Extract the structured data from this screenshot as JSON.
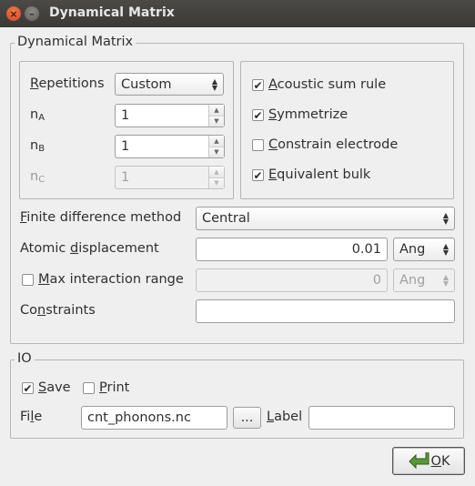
{
  "window": {
    "title": "Dynamical Matrix",
    "close_glyph": "×",
    "minimize_glyph": "–"
  },
  "dynamical_matrix_group": {
    "legend": "Dynamical Matrix",
    "repetitions": {
      "label_mnemonic": "R",
      "label_rest": "epetitions",
      "value": "Custom"
    },
    "n_a": {
      "base": "n",
      "sub": "A",
      "value": "1"
    },
    "n_b": {
      "base": "n",
      "sub": "B",
      "value": "1"
    },
    "n_c": {
      "base": "n",
      "sub": "C",
      "value": "1"
    },
    "checkboxes": {
      "acoustic_sum_rule": {
        "mnemonic": "A",
        "rest": "coustic sum rule",
        "checked": true
      },
      "symmetrize": {
        "mnemonic": "S",
        "rest": "ymmetrize",
        "checked": true
      },
      "constrain_electrode": {
        "mnemonic": "C",
        "rest": "onstrain electrode",
        "checked": false
      },
      "equivalent_bulk": {
        "mnemonic": "E",
        "rest": "quivalent bulk",
        "checked": true
      }
    },
    "finite_difference": {
      "label_mnemonic": "F",
      "label_rest": "inite difference method",
      "value": "Central"
    },
    "atomic_displacement": {
      "label_pre": "Atomic ",
      "label_mnemonic": "d",
      "label_rest": "isplacement",
      "value": "0.01",
      "unit": "Ang"
    },
    "max_interaction_range": {
      "mnemonic": "M",
      "rest": "ax interaction range",
      "checked": false,
      "value": "0",
      "unit": "Ang"
    },
    "constraints": {
      "label_pre": "Co",
      "label_mnemonic": "n",
      "label_rest": "straints",
      "value": ""
    }
  },
  "io_group": {
    "legend": "IO",
    "save": {
      "mnemonic": "S",
      "rest": "ave",
      "checked": true
    },
    "print": {
      "mnemonic": "P",
      "rest": "rint",
      "checked": false
    },
    "file": {
      "label_pre": "Fi",
      "label_mnemonic": "l",
      "label_rest": "e",
      "value": "cnt_phonons.nc",
      "browse_label": "..."
    },
    "label_field": {
      "label_mnemonic": "L",
      "label_rest": "abel",
      "value": ""
    }
  },
  "ok_button": {
    "mnemonic": "O",
    "rest": "K"
  },
  "icons": {
    "ok": "green-arrow-icon",
    "check_glyph": "✔",
    "spin_up": "▲",
    "spin_down": "▼"
  },
  "colors": {
    "titlebar": "#3c3b37",
    "close_button": "#e05a2b",
    "window_bg": "#efefef",
    "ok_arrow": "#4f8a2c"
  }
}
